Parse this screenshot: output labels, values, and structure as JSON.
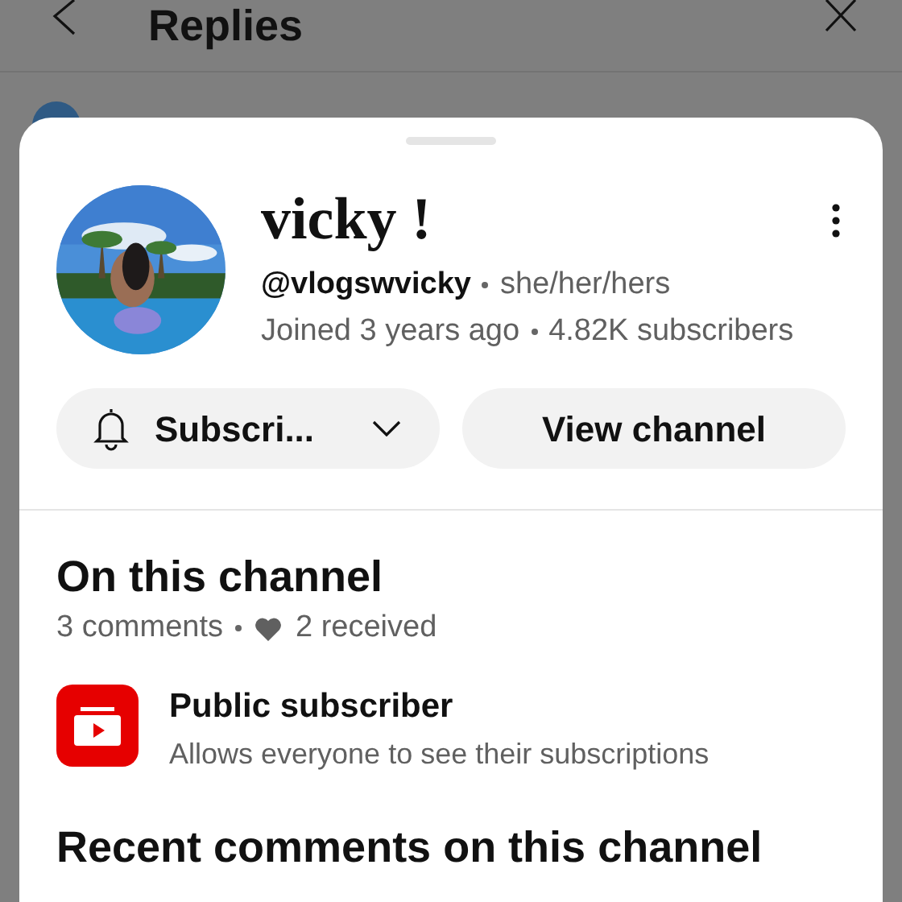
{
  "header": {
    "title": "Replies"
  },
  "profile": {
    "name": "vicky !",
    "handle": "@vlogswvicky",
    "pronouns": "she/her/hers",
    "joined": "Joined 3 years ago",
    "subscribers": "4.82K subscribers"
  },
  "buttons": [
    {
      "kind": "subscribe",
      "label": "Subscri..."
    },
    {
      "kind": "plain",
      "label": "View channel"
    }
  ],
  "on_this_channel": {
    "title": "On this channel",
    "comments": "3 comments",
    "received": "2 received"
  },
  "badge": {
    "title": "Public subscriber",
    "description": "Allows everyone to see their subscriptions"
  },
  "recent": {
    "title": "Recent comments on this channel"
  }
}
